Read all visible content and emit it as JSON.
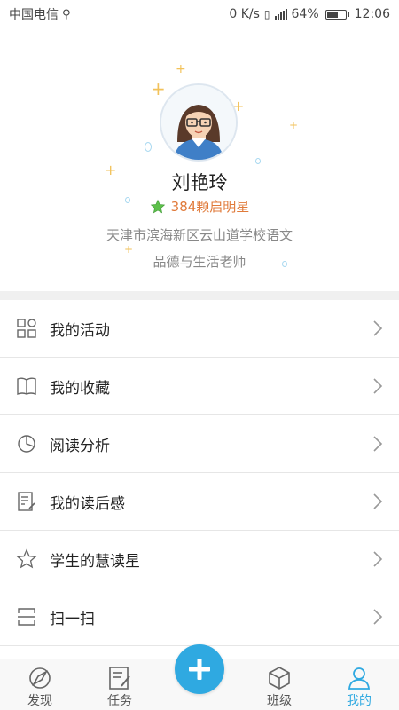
{
  "status_bar": {
    "carrier": "中国电信",
    "net_speed": "0 K/s",
    "battery_percent": "64%",
    "battery_level": 0.64,
    "time": "12:06"
  },
  "profile": {
    "name": "刘艳玲",
    "stars": "384颗启明星",
    "school": "天津市滨海新区云山道学校语文",
    "subject": "品德与生活老师"
  },
  "menu": [
    {
      "label": "我的活动",
      "icon": "grid-icon"
    },
    {
      "label": "我的收藏",
      "icon": "book-icon"
    },
    {
      "label": "阅读分析",
      "icon": "pie-chart-icon"
    },
    {
      "label": "我的读后感",
      "icon": "note-edit-icon"
    },
    {
      "label": "学生的慧读星",
      "icon": "star-icon"
    },
    {
      "label": "扫一扫",
      "icon": "scan-icon"
    }
  ],
  "tabbar": [
    {
      "label": "发现",
      "icon": "compass-icon"
    },
    {
      "label": "任务",
      "icon": "task-edit-icon"
    },
    {
      "label": "",
      "icon": "plus-icon"
    },
    {
      "label": "班级",
      "icon": "cube-icon"
    },
    {
      "label": "我的",
      "icon": "person-icon",
      "active": true
    }
  ],
  "colors": {
    "accent": "#2fa9e1",
    "star_text": "#e07a3a",
    "sparkle": "#f2c25a"
  }
}
